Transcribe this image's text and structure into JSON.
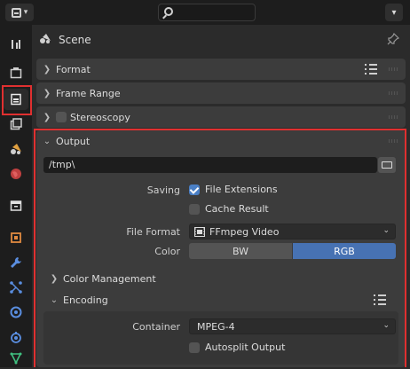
{
  "topbar": {
    "editor_type_icon": "properties-editor-icon",
    "search_icon": "search-icon",
    "options_icon": "chevron-down-icon"
  },
  "sidebar": {
    "tabs": [
      {
        "name": "tool-tab",
        "icon": "tool-icon"
      },
      {
        "name": "render-tab",
        "icon": "render-icon"
      },
      {
        "name": "output-tab",
        "icon": "printer-icon",
        "active": true
      },
      {
        "name": "view-layer-tab",
        "icon": "view-layer-icon"
      },
      {
        "name": "scene-tab",
        "icon": "scene-icon"
      },
      {
        "name": "world-tab",
        "icon": "world-icon"
      },
      {
        "name": "collection-tab",
        "icon": "collection-icon"
      },
      {
        "name": "object-tab",
        "icon": "object-icon"
      },
      {
        "name": "modifiers-tab",
        "icon": "wrench-icon"
      },
      {
        "name": "particles-tab",
        "icon": "particles-icon"
      },
      {
        "name": "physics-tab",
        "icon": "physics-icon"
      },
      {
        "name": "constraints-tab",
        "icon": "constraints-icon"
      },
      {
        "name": "data-tab",
        "icon": "data-icon"
      }
    ]
  },
  "header": {
    "context": "Scene"
  },
  "panels": {
    "format": "Format",
    "frame_range": "Frame Range",
    "stereoscopy": "Stereoscopy",
    "output": "Output"
  },
  "output": {
    "path": "/tmp\\",
    "saving_label": "Saving",
    "file_extensions": "File Extensions",
    "cache_result": "Cache Result",
    "file_format_label": "File Format",
    "file_format_value": "FFmpeg Video",
    "color_label": "Color",
    "color_bw": "BW",
    "color_rgb": "RGB",
    "color_management": "Color Management",
    "encoding": "Encoding",
    "container_label": "Container",
    "container_value": "MPEG-4",
    "autosplit": "Autosplit Output"
  },
  "colors": {
    "accent": "#4772b3",
    "highlight_box": "#e03030"
  }
}
